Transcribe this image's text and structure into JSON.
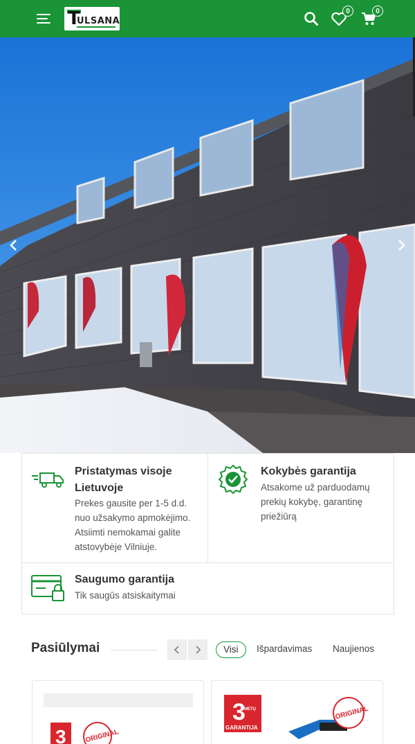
{
  "header": {
    "menu_icon": "hamburger-menu-icon",
    "logo_text": "ULSANA",
    "logo_letter": "T",
    "search_icon": "search-icon",
    "wishlist_icon": "heart-icon",
    "wishlist_count": "0",
    "cart_icon": "cart-icon",
    "cart_count": "0",
    "brand_color": "#1a9436"
  },
  "hero": {
    "prev_icon": "chevron-left-icon",
    "next_icon": "chevron-right-icon",
    "image_description": "store-building-photo"
  },
  "features": [
    {
      "icon": "delivery-truck-icon",
      "title": "Pristatymas visoje Lietuvoje",
      "title_line1": "Pristatymas visoje",
      "title_line2": "Lietuvoje",
      "desc_lines": [
        "Prekes gausite per 1-5 d.d.",
        "nuo užsakymo apmokėjimo.",
        "Atsiimti nemokamai galite",
        "atstovybėje Vilniuje."
      ]
    },
    {
      "icon": "quality-badge-icon",
      "title": "Kokybės garantija",
      "desc_lines": [
        "Atsakome už parduodamų",
        "prekių kokybę, garantinę",
        "priežiūrą"
      ]
    },
    {
      "icon": "secure-payment-icon",
      "title": "Saugumo garantija",
      "desc_lines": [
        "Tik saugūs atsiskaitymai"
      ]
    }
  ],
  "offers": {
    "title": "Pasiūlymai",
    "prev_icon": "chevron-left-icon",
    "next_icon": "chevron-right-icon",
    "filters": [
      "Visi",
      "Išpardavimas",
      "Naujienos"
    ],
    "active_filter": "Visi",
    "badge_text": "GARANTIJA",
    "badge_number": "3",
    "badge_small": "METŲ",
    "original_text": "ORIGINAL"
  }
}
